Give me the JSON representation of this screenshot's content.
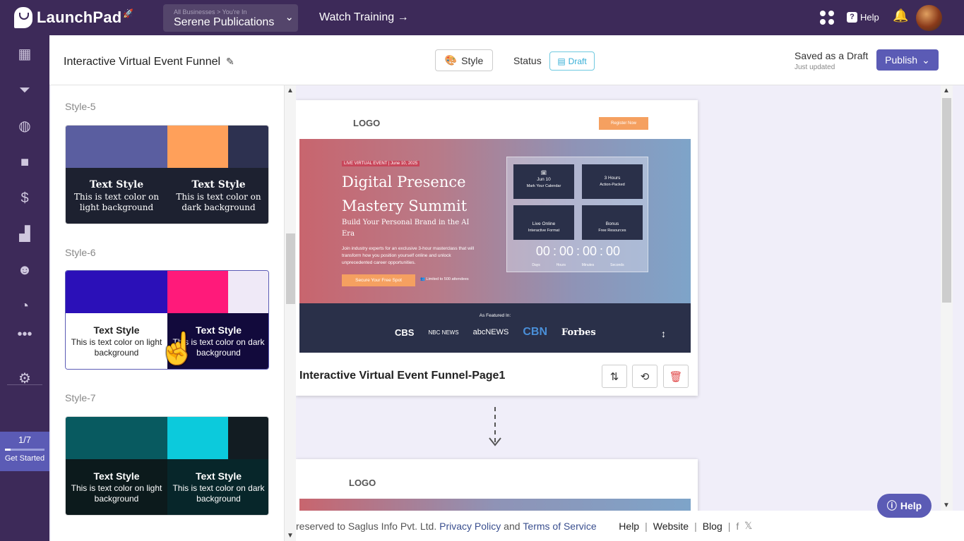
{
  "topbar": {
    "brand": "LaunchPad",
    "business_small": "All Businesses > You're In",
    "business_name": "Serene Publications",
    "watch_training": "Watch Training →",
    "help": "Help"
  },
  "sidenav": {
    "items": [
      "dashboard-icon",
      "funnel-icon",
      "globe-icon",
      "video-icon",
      "dollar-icon",
      "chart-icon",
      "users-icon",
      "analytics-icon",
      "more-icon"
    ],
    "get_started_count": "1/7",
    "get_started_label": "Get Started",
    "progress": 0.14
  },
  "header": {
    "title": "Interactive Virtual Event Funnel",
    "style_btn": "Style",
    "status_label": "Status",
    "status_value": "Draft",
    "saved": "Saved as a Draft",
    "saved_sub": "Just updated",
    "publish": "Publish"
  },
  "styles": [
    {
      "label": "Style-5",
      "colors": [
        "#5a5ea0",
        "#ffa05a",
        "#2d3150"
      ],
      "serif": true,
      "light_bg": "#1d2130",
      "dark_bg": "#1d2130",
      "light_fg": "#ffffff",
      "dark_fg": "#ffffff",
      "heading": "Text Style",
      "light_text": "This is text color on light background",
      "dark_text": "This is text color on dark background"
    },
    {
      "label": "Style-6",
      "colors": [
        "#2b10b8",
        "#ff1a7a",
        "#efe9f7"
      ],
      "serif": false,
      "light_bg": "#ffffff",
      "dark_bg": "#120a3c",
      "light_fg": "#222222",
      "dark_fg": "#ffffff",
      "heading": "Text Style",
      "light_text": "This is text color on light background",
      "dark_text": "This is text color on dark background"
    },
    {
      "label": "Style-7",
      "colors": [
        "#085a60",
        "#0ccadc",
        "#121c22"
      ],
      "serif": false,
      "light_bg": "#0c1a1c",
      "dark_bg": "#07262a",
      "light_fg": "#ffffff",
      "dark_fg": "#ffffff",
      "heading": "Text Style",
      "light_text": "This is text color on light background",
      "dark_text": "This is text color on dark background"
    }
  ],
  "page1": {
    "logo": "LOGO",
    "register": "Register Now",
    "badge": "LIVE VIRTUAL EVENT | June 10, 2025",
    "title": "Digital Presence Mastery Summit",
    "subtitle": "Build Your Personal Brand in the AI Era",
    "desc": "Join industry experts for an exclusive 3-hour masterclass that will transform how you position yourself online and unlock unprecedented career opportunities.",
    "cta": "Secure Your Free Spot",
    "limit": "Limited to 500 attendees",
    "info": [
      {
        "a": "Jun 10",
        "b": "Mark Your Calendar"
      },
      {
        "a": "3 Hours",
        "b": "Action-Packed"
      },
      {
        "a": "Live Online",
        "b": "Interactive Format"
      },
      {
        "a": "Bonus",
        "b": "Free Resources"
      }
    ],
    "countdown": [
      "00",
      "00",
      "00",
      "00"
    ],
    "countdown_labels": [
      "Days",
      "Hours",
      "Minutes",
      "Seconds"
    ],
    "featured_label": "As Featured In:",
    "featured_logos": [
      "CBS",
      "NBC NEWS",
      "abcNEWS",
      "CBN",
      "Forbes"
    ],
    "name": "Interactive Virtual Event Funnel-Page1"
  },
  "page2": {
    "logo": "LOGO"
  },
  "footer": {
    "copyright": "reserved to Saglus Info Pvt. Ltd.",
    "privacy": "Privacy Policy",
    "and": "and",
    "terms": "Terms of Service",
    "help": "Help",
    "website": "Website",
    "blog": "Blog"
  },
  "help_float": "Help"
}
